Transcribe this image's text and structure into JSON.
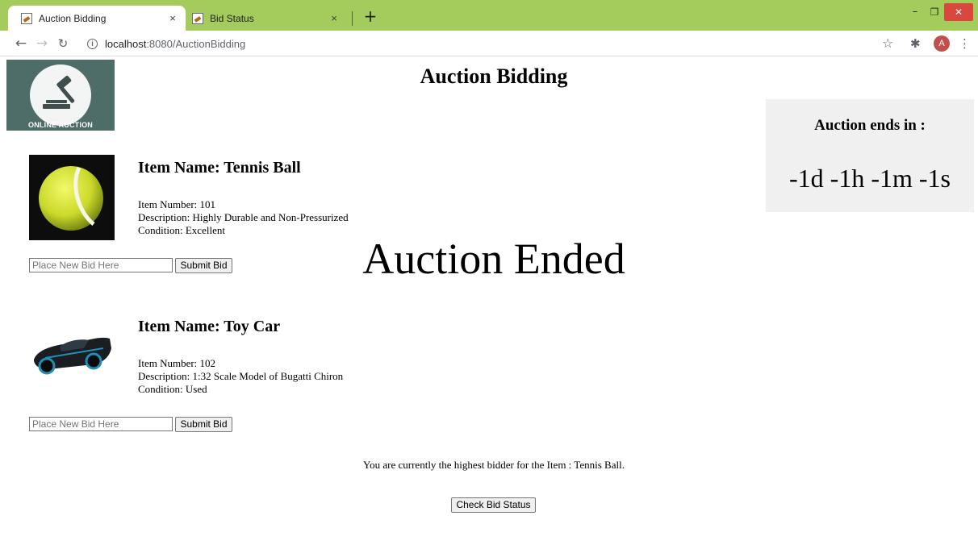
{
  "browser": {
    "tabs": [
      {
        "title": "Auction Bidding",
        "active": true
      },
      {
        "title": "Bid Status",
        "active": false
      }
    ],
    "close_glyph": "×",
    "new_tab_glyph": "+",
    "address": {
      "host": "localhost",
      "path": ":8080/AuctionBidding"
    },
    "avatar_initial": "A",
    "accent_color": "#a4cc5c"
  },
  "page": {
    "logo_text": "ONLINE AUCTION",
    "title": "Auction Bidding",
    "countdown": {
      "label": "Auction ends in :",
      "value": "-1d -1h -1m -1s"
    },
    "status_banner": "Auction Ended",
    "items": [
      {
        "name": "Item Name: Tennis Ball",
        "number": "Item Number: 101",
        "description": "Description: Highly Durable and Non-Pressurized",
        "condition": "Condition: Excellent",
        "bid_placeholder": "Place New Bid Here",
        "submit_label": "Submit Bid",
        "image_icon": "tennis-ball-icon"
      },
      {
        "name": "Item Name: Toy Car",
        "number": "Item Number: 102",
        "description": "Description: 1:32 Scale Model of Bugatti Chiron",
        "condition": "Condition: Used",
        "bid_placeholder": "Place New Bid Here",
        "submit_label": "Submit Bid",
        "image_icon": "toy-car-icon"
      }
    ],
    "highest_bidder_message": "You are currently the highest bidder for the Item : Tennis Ball.",
    "check_status_label": "Check Bid Status"
  }
}
